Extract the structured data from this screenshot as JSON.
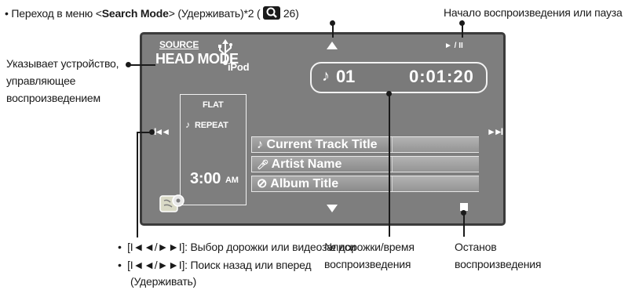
{
  "top_note": {
    "prefix": "Переход в меню <",
    "mode_name": "Search Mode",
    "suffix": "> (Удерживать)*2 (",
    "page_ref": "26",
    "close": ")"
  },
  "labels": {
    "play_pause": "Начало воспроизведения или пауза",
    "device_line1": "Указывает устройство,",
    "device_line2": "управляющее",
    "device_line3": "воспроизведением",
    "track_time_line1": "№ дорожки/время",
    "track_time_line2": "воспроизведения",
    "stop_line1": "Останов",
    "stop_line2": "воспроизведения",
    "skip_item1": "[I◄◄/►►I]: Выбор дорожки или видеозаписи",
    "skip_item2_line1": "[I◄◄/►►I]: Поиск назад или вперед",
    "skip_item2_line2": "(Удерживать)"
  },
  "screen": {
    "source_label": "SOURCE",
    "head_mode": "HEAD MODE",
    "ipod": "iPod",
    "track_number": "01",
    "play_time": "0:01:20",
    "play_pause_glyph": "► / II",
    "sound_mode": "FLAT",
    "repeat": "REPEAT",
    "clock": "3:00",
    "ampm": "AM",
    "track_title": "Current Track Title",
    "artist": "Artist Name",
    "album": "Album Title",
    "prev_glyph": "I◄◄",
    "next_glyph": "►►I"
  }
}
